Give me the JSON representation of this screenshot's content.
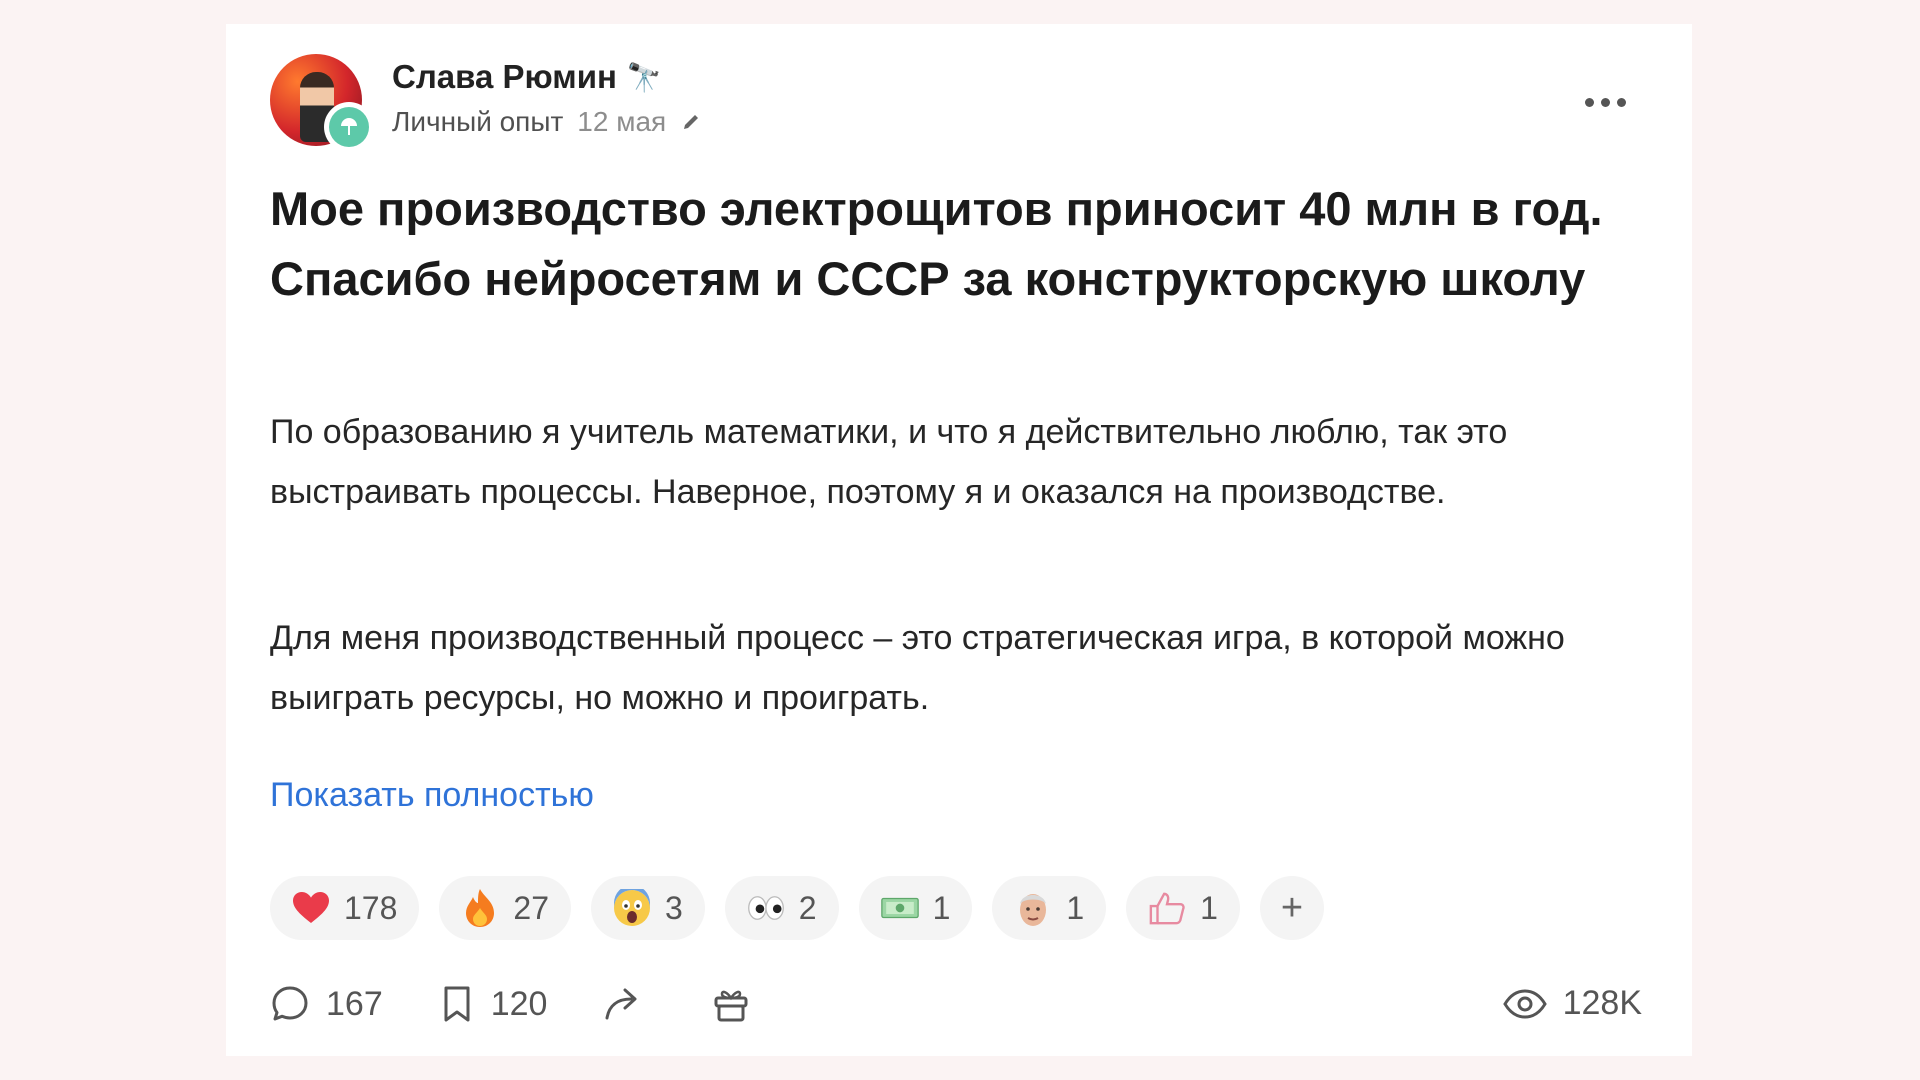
{
  "post": {
    "author_name": "Слава Рюмин",
    "author_emoji": "🔭",
    "category": "Личный опыт",
    "date": "12 мая",
    "title": "Мое производство электрощитов приносит 40 млн в год. Спасибо нейросетям и СССР за конструкторскую школу",
    "paragraphs": [
      "По образованию я учитель математики, и что я действительно люблю, так это выстраивать процессы. Наверное, поэтому я и оказался на производстве.",
      "Для меня производственный процесс – это стратегическая игра, в которой можно выиграть ресурсы, но можно и проиграть."
    ],
    "show_more_label": "Показать полностью"
  },
  "reactions": [
    {
      "icon": "heart-icon",
      "count": "178"
    },
    {
      "icon": "fire-icon",
      "count": "27"
    },
    {
      "icon": "scream-icon",
      "count": "3"
    },
    {
      "icon": "eyes-icon",
      "count": "2"
    },
    {
      "icon": "money-icon",
      "count": "1"
    },
    {
      "icon": "face-icon",
      "count": "1"
    },
    {
      "icon": "thumbs-up-icon",
      "count": "1"
    }
  ],
  "add_reaction_label": "+",
  "actions": {
    "comments": "167",
    "bookmarks": "120",
    "views": "128K"
  },
  "colors": {
    "background": "#fbf3f3",
    "link": "#2f73d8",
    "heart": "#ea3b4a"
  }
}
